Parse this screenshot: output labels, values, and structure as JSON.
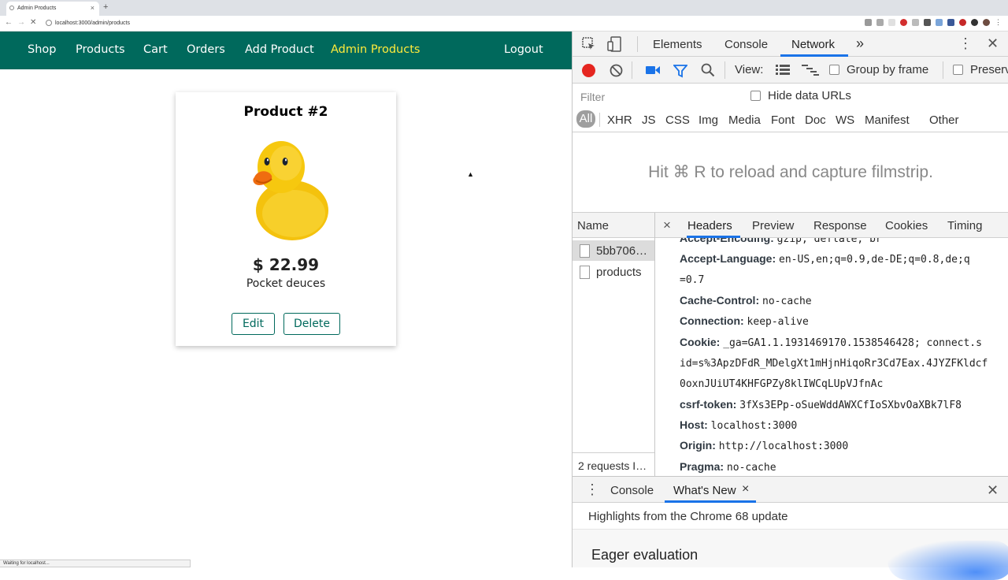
{
  "browser": {
    "tab_title": "Admin Products",
    "tab_close": "×",
    "new_tab": "+",
    "url": "localhost:3000/admin/products",
    "status_text": "Waiting for localhost..."
  },
  "app": {
    "nav": {
      "shop": "Shop",
      "products": "Products",
      "cart": "Cart",
      "orders": "Orders",
      "add_product": "Add Product",
      "admin_products": "Admin Products",
      "logout": "Logout"
    },
    "product": {
      "title": "Product #2",
      "price": "$ 22.99",
      "description": "Pocket deuces",
      "edit_label": "Edit",
      "delete_label": "Delete"
    },
    "colors": {
      "nav_bg": "#00695c",
      "active_link": "#ffeb3b"
    }
  },
  "devtools": {
    "tabs": {
      "elements": "Elements",
      "console": "Console",
      "network": "Network",
      "more": "»"
    },
    "toolbar": {
      "view_label": "View:",
      "group_by_frame": "Group by frame",
      "preserve_log": "Preserv"
    },
    "filter": {
      "placeholder": "Filter",
      "hide_data_urls": "Hide data URLs"
    },
    "types": [
      "All",
      "XHR",
      "JS",
      "CSS",
      "Img",
      "Media",
      "Font",
      "Doc",
      "WS",
      "Manifest",
      "Other"
    ],
    "filmstrip_msg": "Hit ⌘ R to reload and capture filmstrip.",
    "requests_header": {
      "name": "Name",
      "close": "×",
      "headers": "Headers",
      "preview": "Preview",
      "response": "Response",
      "cookies": "Cookies",
      "timing": "Timing"
    },
    "requests": [
      "5bb706…",
      "products"
    ],
    "requests_footer": "2 requests I…",
    "headers": [
      {
        "key": "Accept-Encoding:",
        "val": "gzip, deflate, br"
      },
      {
        "key": "Accept-Language:",
        "val": "en-US,en;q=0.9,de-DE;q=0.8,de;q"
      },
      {
        "key": "",
        "val": "=0.7"
      },
      {
        "key": "Cache-Control:",
        "val": "no-cache"
      },
      {
        "key": "Connection:",
        "val": "keep-alive"
      },
      {
        "key": "Cookie:",
        "val": "_ga=GA1.1.1931469170.1538546428; connect.s"
      },
      {
        "key": "",
        "val": "id=s%3ApzDFdR_MDelgXt1mHjnHiqoRr3Cd7Eax.4JYZFKldcf"
      },
      {
        "key": "",
        "val": "0oxnJUiUT4KHFGPZy8klIWCqLUpVJfnAc"
      },
      {
        "key": "csrf-token:",
        "val": "3fXs3EPp-oSueWddAWXCfIoSXbvOaXBk7lF8"
      },
      {
        "key": "Host:",
        "val": "localhost:3000"
      },
      {
        "key": "Origin:",
        "val": "http://localhost:3000"
      },
      {
        "key": "Pragma:",
        "val": "no-cache"
      }
    ],
    "drawer": {
      "console": "Console",
      "whats_new": "What's New",
      "close": "×",
      "highlights": "Highlights from the Chrome 68 update",
      "eager": "Eager evaluation"
    },
    "colors": {
      "accent": "#1a73e8",
      "record": "#e52620"
    }
  }
}
